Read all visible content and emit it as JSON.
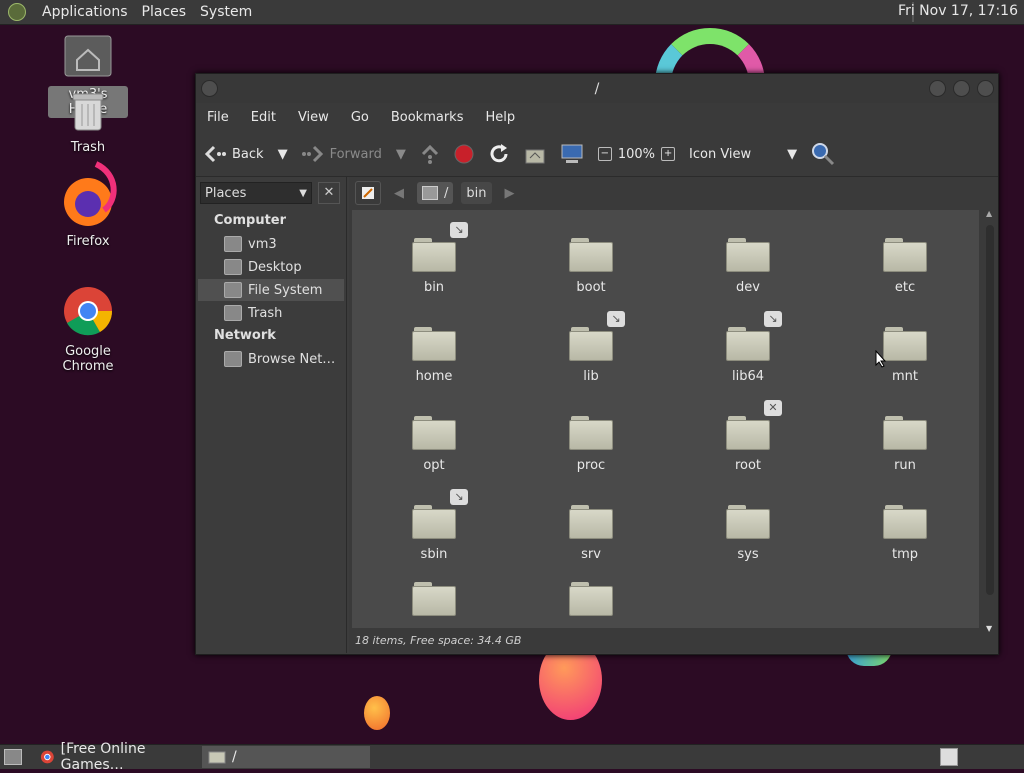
{
  "top_panel": {
    "menu": [
      "Applications",
      "Places",
      "System"
    ],
    "clock": "Fri Nov 17, 17:16"
  },
  "desktop": {
    "icons": [
      {
        "label": "vm3's Home",
        "icon": "home-folder-icon"
      },
      {
        "label": "Trash",
        "icon": "trash-icon"
      },
      {
        "label": "Firefox",
        "icon": "firefox-icon"
      },
      {
        "label": "Google Chrome",
        "icon": "chrome-icon"
      }
    ]
  },
  "window": {
    "title": "/",
    "menu": [
      "File",
      "Edit",
      "View",
      "Go",
      "Bookmarks",
      "Help"
    ],
    "toolbar": {
      "back": "Back",
      "forward": "Forward",
      "zoom": "100%",
      "view_mode": "Icon View"
    },
    "sidebar": {
      "selector": "Places",
      "sections": [
        {
          "heading": "Computer",
          "items": [
            {
              "label": "vm3",
              "icon": "home-icon"
            },
            {
              "label": "Desktop",
              "icon": "desktop-icon"
            },
            {
              "label": "File System",
              "icon": "drive-icon",
              "selected": true
            },
            {
              "label": "Trash",
              "icon": "trash-icon"
            }
          ]
        },
        {
          "heading": "Network",
          "items": [
            {
              "label": "Browse Net…",
              "icon": "network-icon"
            }
          ]
        }
      ]
    },
    "pathbar": {
      "segments": [
        "/",
        "bin"
      ]
    },
    "files": [
      {
        "name": "bin",
        "emblem": "link"
      },
      {
        "name": "boot",
        "emblem": ""
      },
      {
        "name": "dev",
        "emblem": ""
      },
      {
        "name": "etc",
        "emblem": ""
      },
      {
        "name": "home",
        "emblem": ""
      },
      {
        "name": "lib",
        "emblem": "link"
      },
      {
        "name": "lib64",
        "emblem": "link"
      },
      {
        "name": "mnt",
        "emblem": ""
      },
      {
        "name": "opt",
        "emblem": ""
      },
      {
        "name": "proc",
        "emblem": ""
      },
      {
        "name": "root",
        "emblem": "unreadable"
      },
      {
        "name": "run",
        "emblem": ""
      },
      {
        "name": "sbin",
        "emblem": "link"
      },
      {
        "name": "srv",
        "emblem": ""
      },
      {
        "name": "sys",
        "emblem": ""
      },
      {
        "name": "tmp",
        "emblem": ""
      },
      {
        "name": "",
        "emblem": ""
      },
      {
        "name": "",
        "emblem": ""
      }
    ],
    "status": "18 items, Free space: 34.4 GB"
  },
  "taskbar": {
    "tasks": [
      {
        "label": "[Free Online Games…",
        "icon": "chrome-icon"
      },
      {
        "label": "/",
        "icon": "folder-icon"
      }
    ]
  },
  "colors": {
    "wallpaper": "#2c0b24",
    "panel": "#3a3a3a",
    "window": "#3c3c3c",
    "icon_area": "#4a4a4a",
    "stop": "#c8202a"
  }
}
